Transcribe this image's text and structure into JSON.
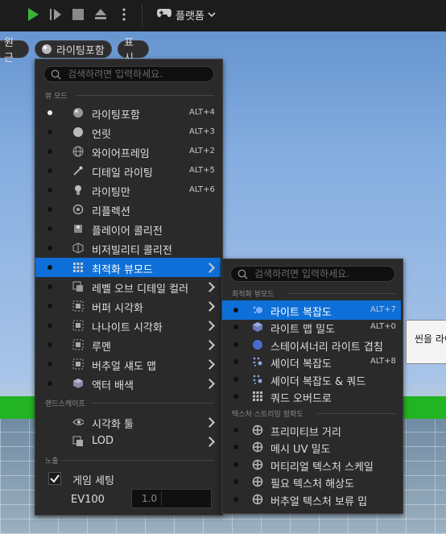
{
  "toolbar": {
    "platform_label": "플랫폼"
  },
  "viewport_bar": {
    "perspective_label": "원근",
    "view_mode_label": "라이팅포함",
    "show_label": "표시"
  },
  "view_mode_menu": {
    "search_placeholder": "검색하려면 입력하세요.",
    "section_view_mode": "뷰 모드",
    "items": [
      {
        "label": "라이팅포함",
        "shortcut": "ALT+4",
        "icon": "lit-sphere-icon",
        "active": true
      },
      {
        "label": "언릿",
        "shortcut": "ALT+3",
        "icon": "unlit-sphere-icon",
        "active": false
      },
      {
        "label": "와이어프레임",
        "shortcut": "ALT+2",
        "icon": "wireframe-sphere-icon",
        "active": false
      },
      {
        "label": "디테일 라이팅",
        "shortcut": "ALT+5",
        "icon": "detail-lighting-icon",
        "active": false
      },
      {
        "label": "라이팅만",
        "shortcut": "ALT+6",
        "icon": "lightbulb-icon",
        "active": false
      },
      {
        "label": "리플렉션",
        "shortcut": "",
        "icon": "reflection-icon",
        "active": false
      },
      {
        "label": "플레이어 콜리전",
        "shortcut": "",
        "icon": "player-collision-icon",
        "active": false
      },
      {
        "label": "비저빌리티 콜리전",
        "shortcut": "",
        "icon": "visibility-collision-icon",
        "active": false
      },
      {
        "label": "최적화 뷰모드",
        "shortcut": "",
        "icon": "optimization-grid-icon",
        "active": false,
        "submenu": true,
        "selected": true
      },
      {
        "label": "레벨 오브 디테일 컬러",
        "shortcut": "",
        "icon": "lod-color-icon",
        "active": false,
        "submenu": true
      },
      {
        "label": "버퍼 시각화",
        "shortcut": "",
        "icon": "buffer-visualization-icon",
        "active": false,
        "submenu": true
      },
      {
        "label": "나나이트 시각화",
        "shortcut": "",
        "icon": "nanite-visualization-icon",
        "active": false,
        "submenu": true
      },
      {
        "label": "루멘",
        "shortcut": "",
        "icon": "lumen-icon",
        "active": false,
        "submenu": true
      },
      {
        "label": "버추얼 섀도 맵",
        "shortcut": "",
        "icon": "virtual-shadow-map-icon",
        "active": false,
        "submenu": true
      },
      {
        "label": "액터 배색",
        "shortcut": "",
        "icon": "actor-coloration-icon",
        "active": false,
        "submenu": true
      }
    ],
    "section_landscape": "랜드스케이프",
    "landscape_items": [
      {
        "label": "시각화 툴",
        "icon": "visualizer-eye-icon"
      },
      {
        "label": "LOD",
        "icon": "lod-icon"
      }
    ],
    "section_exposure": "노출",
    "game_settings_label": "게임 세팅",
    "game_settings_checked": true,
    "ev100_label": "EV100",
    "ev100_value": "1.0"
  },
  "optimization_submenu": {
    "search_placeholder": "검색하려면 입력하세요.",
    "section_optimization": "최적화 뷰모드",
    "items": [
      {
        "label": "라이트 복잡도",
        "shortcut": "ALT+7",
        "icon": "light-complexity-icon",
        "selected": true
      },
      {
        "label": "라이트 맵 밀도",
        "shortcut": "ALT+0",
        "icon": "lightmap-density-icon"
      },
      {
        "label": "스테이셔너리 라이트 겹침",
        "shortcut": "",
        "icon": "stationary-light-overlap-icon"
      },
      {
        "label": "셰이더 복잡도",
        "shortcut": "ALT+8",
        "icon": "shader-complexity-icon"
      },
      {
        "label": "셰이더 복잡도 & 쿼드",
        "shortcut": "",
        "icon": "shader-complexity-quads-icon"
      },
      {
        "label": "쿼드 오버드로",
        "shortcut": "",
        "icon": "quad-overdraw-icon"
      }
    ],
    "section_streaming": "텍스처 스트리밍 정확도",
    "streaming_items": [
      {
        "label": "프리미티브 거리",
        "icon": "crosshair-icon"
      },
      {
        "label": "메시 UV 밀도",
        "icon": "crosshair-icon"
      },
      {
        "label": "머티리얼 텍스처 스케일",
        "icon": "crosshair-icon"
      },
      {
        "label": "필요 텍스처 해상도",
        "icon": "crosshair-icon"
      },
      {
        "label": "버추얼 텍스처 보류 밉",
        "icon": "crosshair-icon"
      }
    ]
  },
  "tooltip": {
    "text": "씬을 라이"
  },
  "colors": {
    "accent": "#0e6fd8",
    "play_green": "#3bb33b"
  }
}
